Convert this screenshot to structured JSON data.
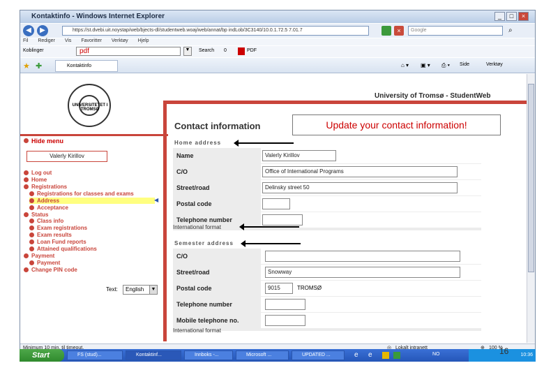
{
  "window": {
    "title": "Kontaktinfo - Windows Internet Explorer"
  },
  "address_bar": {
    "url": "https://st.dvebi.uit.noystap/web/bjects-dl/studentweb.woaj/web/annat/bp indLob/3C3140/10.0.1.72.5 7.01.7",
    "search_placeholder": "Google"
  },
  "menubar": {
    "items": [
      "Fil",
      "Rediger",
      "Vis",
      "Favoritter",
      "Verktøy",
      "Hjelp"
    ]
  },
  "toolbar2": {
    "label": "Koblinger",
    "pdf_value": "pdf",
    "search_label": "Search",
    "count": "0",
    "pdf_label": "PDF"
  },
  "tab": {
    "label": "Kontaktinfo"
  },
  "cmdbar": {
    "side": "Side",
    "tools": "Verktøy"
  },
  "page": {
    "header": "University of Tromsø - StudentWeb",
    "logo_text": "UNIVERSITETET I TROMSØ",
    "contact_title": "Contact information",
    "callout": "Update your contact information!",
    "home_address_label": "Home address",
    "semester_address_label": "Semester address",
    "international_format": "International format",
    "home": {
      "rows": [
        {
          "label": "Name",
          "value": "Valerly Kirillov"
        },
        {
          "label": "C/O",
          "value": "Office of International Programs"
        },
        {
          "label": "Street/road",
          "value": "Delinsky street 50"
        },
        {
          "label": "Postal code",
          "value": ""
        },
        {
          "label": "Telephone number",
          "value": ""
        }
      ]
    },
    "semester": {
      "rows": [
        {
          "label": "C/O",
          "value": ""
        },
        {
          "label": "Street/road",
          "value": "Snowway"
        },
        {
          "label": "Postal code",
          "value": "9015",
          "city": "TROMSØ"
        },
        {
          "label": "Telephone number",
          "value": ""
        },
        {
          "label": "Mobile telephone no.",
          "value": ""
        }
      ]
    }
  },
  "sidebar": {
    "hide_menu": "Hide menu",
    "user_name": "Valerly Kirillov",
    "items": [
      "Log out",
      "Home",
      "Registrations",
      "Registrations for classes and exams",
      "Address",
      "Acceptance",
      "Status",
      "Class info",
      "Exam registrations",
      "Exam results",
      "Loan Fund reports",
      "Attained qualifications",
      "Payment",
      "Payment",
      "Change PIN code"
    ],
    "lang_label": "Text:",
    "lang_value": "English"
  },
  "statusbar": {
    "left": "Minimum 10 min. til timeout.",
    "zone": "Lokalt intranett",
    "zoom": "100 %"
  },
  "taskbar": {
    "start": "Start",
    "tasks": [
      "FS (stud)...",
      "Kontaktinf...",
      "Innboks -...",
      "Microsoft ...",
      "UPDATED ..."
    ],
    "tray_lang": "NO",
    "clock": "10:36"
  },
  "page_number": "16"
}
